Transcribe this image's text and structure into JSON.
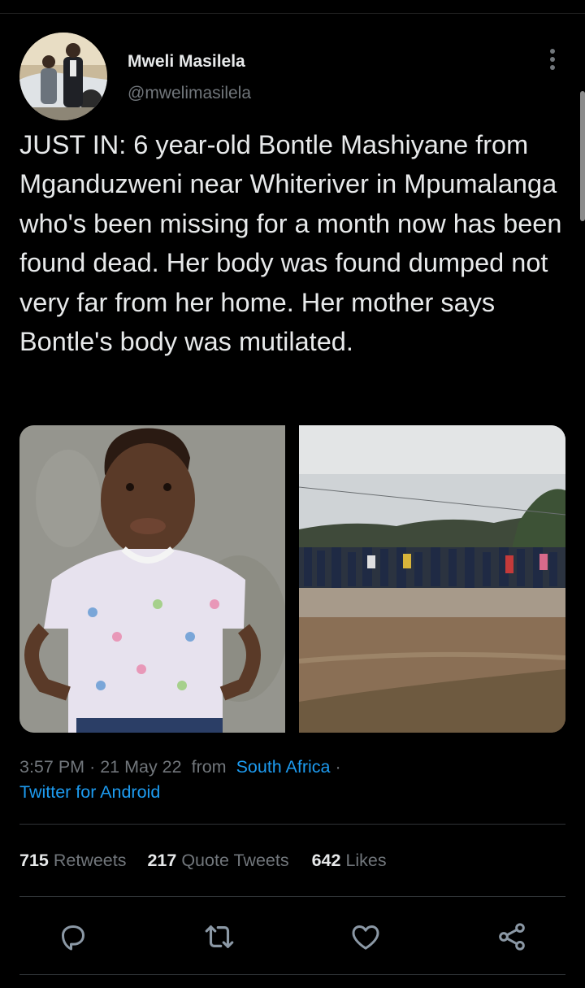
{
  "author": {
    "name": "Mweli Masilela",
    "handle": "@mwelimasilela"
  },
  "tweet": {
    "text": "JUST IN: 6 year-old Bontle Mashiyane from Mganduzweni near Whiteriver in Mpumalanga who's been missing for a month now has been found dead. Her body was found dumped not very far from her home. Her mother says Bontle's body was mutilated."
  },
  "meta": {
    "time": "3:57 PM",
    "date": "21 May 22",
    "from_label": "from",
    "location": "South Africa",
    "source": "Twitter for Android"
  },
  "stats": {
    "retweets_count": "715",
    "retweets_label": "Retweets",
    "quotes_count": "217",
    "quotes_label": "Quote Tweets",
    "likes_count": "642",
    "likes_label": "Likes"
  },
  "icons": {
    "more": "more-vertical-icon",
    "reply": "reply-icon",
    "retweet": "retweet-icon",
    "like": "heart-icon",
    "share": "share-icon"
  },
  "colors": {
    "background": "#000000",
    "text": "#e7e9ea",
    "secondary": "#71767b",
    "link": "#1d9bf0",
    "divider": "#2f3336"
  }
}
